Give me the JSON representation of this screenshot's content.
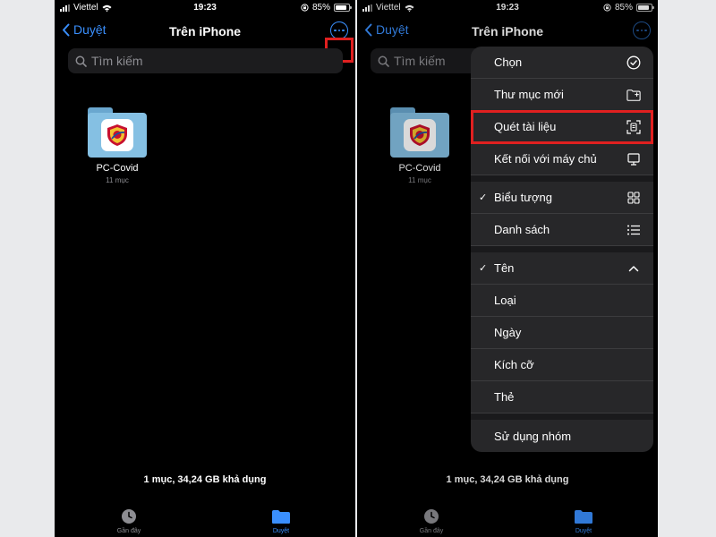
{
  "status": {
    "carrier": "Viettel",
    "time": "19:23",
    "battery": "85%",
    "battery_level": 0.85
  },
  "nav": {
    "back_label": "Duyệt",
    "title": "Trên iPhone"
  },
  "search": {
    "placeholder": "Tìm kiếm"
  },
  "folder": {
    "name": "PC-Covid",
    "count": "11 mục"
  },
  "storage": "1 mục, 34,24 GB khả dụng",
  "tabs": {
    "recent": "Gần đây",
    "browse": "Duyệt"
  },
  "menu": {
    "select": "Chọn",
    "new_folder": "Thư mục mới",
    "scan": "Quét tài liệu",
    "connect": "Kết nối với máy chủ",
    "icons": "Biểu tượng",
    "list": "Danh sách",
    "name": "Tên",
    "kind": "Loại",
    "date": "Ngày",
    "size": "Kích cỡ",
    "tags": "Thẻ",
    "use_groups": "Sử dụng nhóm"
  },
  "colors": {
    "accent": "#3a8ffd",
    "highlight": "#e02020",
    "folder": "#85c0e3"
  }
}
